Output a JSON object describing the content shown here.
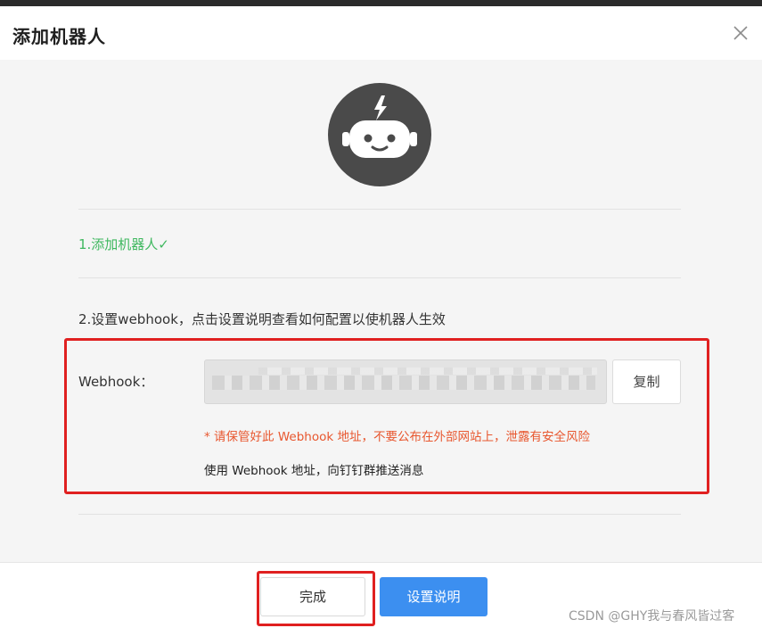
{
  "dialog": {
    "title": "添加机器人"
  },
  "steps": {
    "step1": "1.添加机器人✓",
    "step2": "2.设置webhook，点击设置说明查看如何配置以使机器人生效"
  },
  "webhook": {
    "label": "Webhook：",
    "copy_label": "复制",
    "warning": "* 请保管好此 Webhook 地址，不要公布在外部网站上，泄露有安全风险",
    "usage": "使用 Webhook 地址，向钉钉群推送消息"
  },
  "footer": {
    "done_label": "完成",
    "help_label": "设置说明"
  },
  "watermark": "CSDN @GHY我与春风皆过客",
  "colors": {
    "success": "#3fb85f",
    "warning": "#e8572f",
    "primary": "#3c8ff0",
    "highlight": "#e02020",
    "avatar_bg": "#4a4a4a"
  },
  "icons": {
    "close": "close-icon",
    "robot": "robot-icon"
  }
}
